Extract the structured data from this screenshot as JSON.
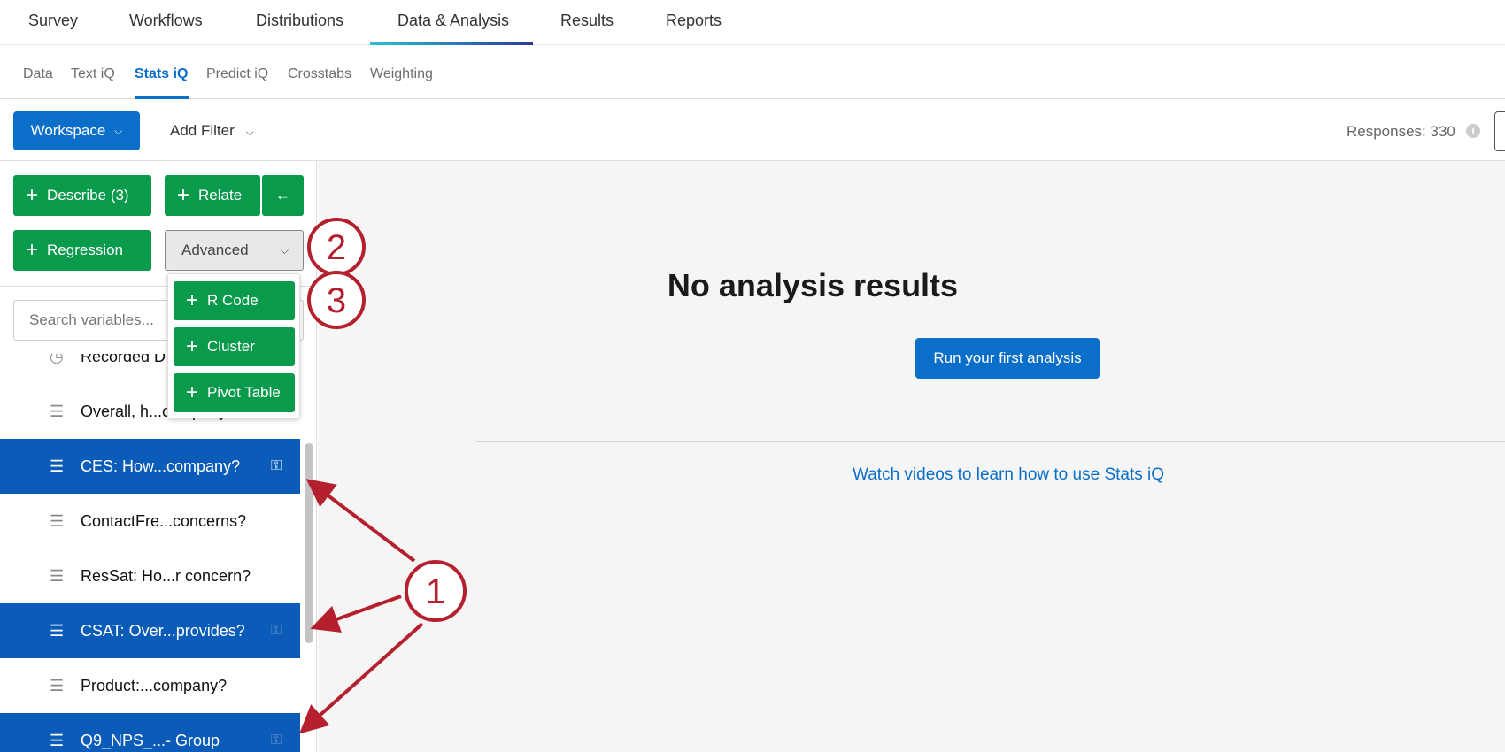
{
  "top_nav": {
    "tabs": [
      "Survey",
      "Workflows",
      "Distributions",
      "Data & Analysis",
      "Results",
      "Reports"
    ],
    "active": "Data & Analysis"
  },
  "sub_nav": {
    "tabs": [
      "Data",
      "Text iQ",
      "Stats iQ",
      "Predict iQ",
      "Crosstabs",
      "Weighting"
    ],
    "active": "Stats iQ"
  },
  "toolbar": {
    "workspace": "Workspace",
    "add_filter": "Add Filter",
    "responses": "Responses: 330"
  },
  "actions": {
    "describe": "Describe (3)",
    "relate": "Relate",
    "relate_arrow": "←",
    "regression": "Regression",
    "advanced": "Advanced"
  },
  "advanced_menu": [
    "R Code",
    "Cluster",
    "Pivot Table"
  ],
  "search": {
    "placeholder": "Search variables..."
  },
  "variables": [
    {
      "label": "Recorded D",
      "icon": "clock-icon",
      "selected": false
    },
    {
      "label": "Overall, h...company?",
      "icon": "list-icon",
      "selected": false
    },
    {
      "label": "CES: How...company?",
      "icon": "list-icon",
      "selected": true,
      "key": true
    },
    {
      "label": "ContactFre...concerns?",
      "icon": "list-icon",
      "selected": false
    },
    {
      "label": "ResSat: Ho...r concern?",
      "icon": "list-icon",
      "selected": false
    },
    {
      "label": "CSAT: Over...provides?",
      "icon": "list-icon",
      "selected": true,
      "key": true
    },
    {
      "label": "Product:...company?",
      "icon": "list-icon",
      "selected": false
    },
    {
      "label": "Q9_NPS_...- Group",
      "icon": "list-icon",
      "selected": true,
      "key": true
    }
  ],
  "main": {
    "title": "No analysis results",
    "run_button": "Run your first analysis",
    "videos_link": "Watch videos to learn how to use Stats iQ"
  },
  "annotations": {
    "one": "1",
    "two": "2",
    "three": "3"
  },
  "colors": {
    "blue": "#0b6fc9",
    "green": "#0a9a4c",
    "selected": "#0b5cb8",
    "annotation": "#b5202e"
  }
}
